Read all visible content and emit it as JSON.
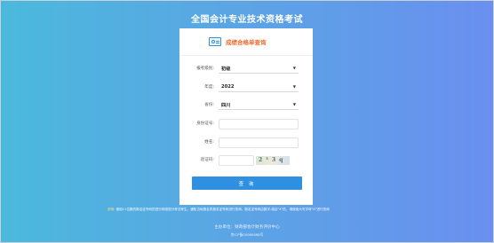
{
  "page": {
    "title": "全国会计专业技术资格考试"
  },
  "card": {
    "title": "成绩合格单查询",
    "icon": "id-card-icon"
  },
  "form": {
    "level": {
      "label": "报考级别:",
      "value": "初级"
    },
    "year": {
      "label": "年度:",
      "value": "2022"
    },
    "province": {
      "label": "省份:",
      "value": "四川"
    },
    "id_number": {
      "label": "身份证号:",
      "value": ""
    },
    "name": {
      "label": "姓名:",
      "value": ""
    },
    "captcha": {
      "label": "验证码:",
      "value": "",
      "image_text": "2 ⁵ 3 q"
    },
    "submit_label": "查 询"
  },
  "notice": {
    "label": "说明:",
    "text": "使用11位数的报名证号码的进行网络查分考试考生，通知当地报名的报名证号码进行查询。报名证号码由数字-组合\"X\"的，请使用大写字母\"X\"进行查询"
  },
  "footer": {
    "org": "主办单位：财政部会计财务评价中心",
    "icp": "京ICP备05060868号"
  },
  "colors": {
    "accent": "#2f8fe0",
    "title_orange": "#f06a2a",
    "bg_start": "#4bb9dc",
    "bg_end": "#6a8ff0"
  }
}
